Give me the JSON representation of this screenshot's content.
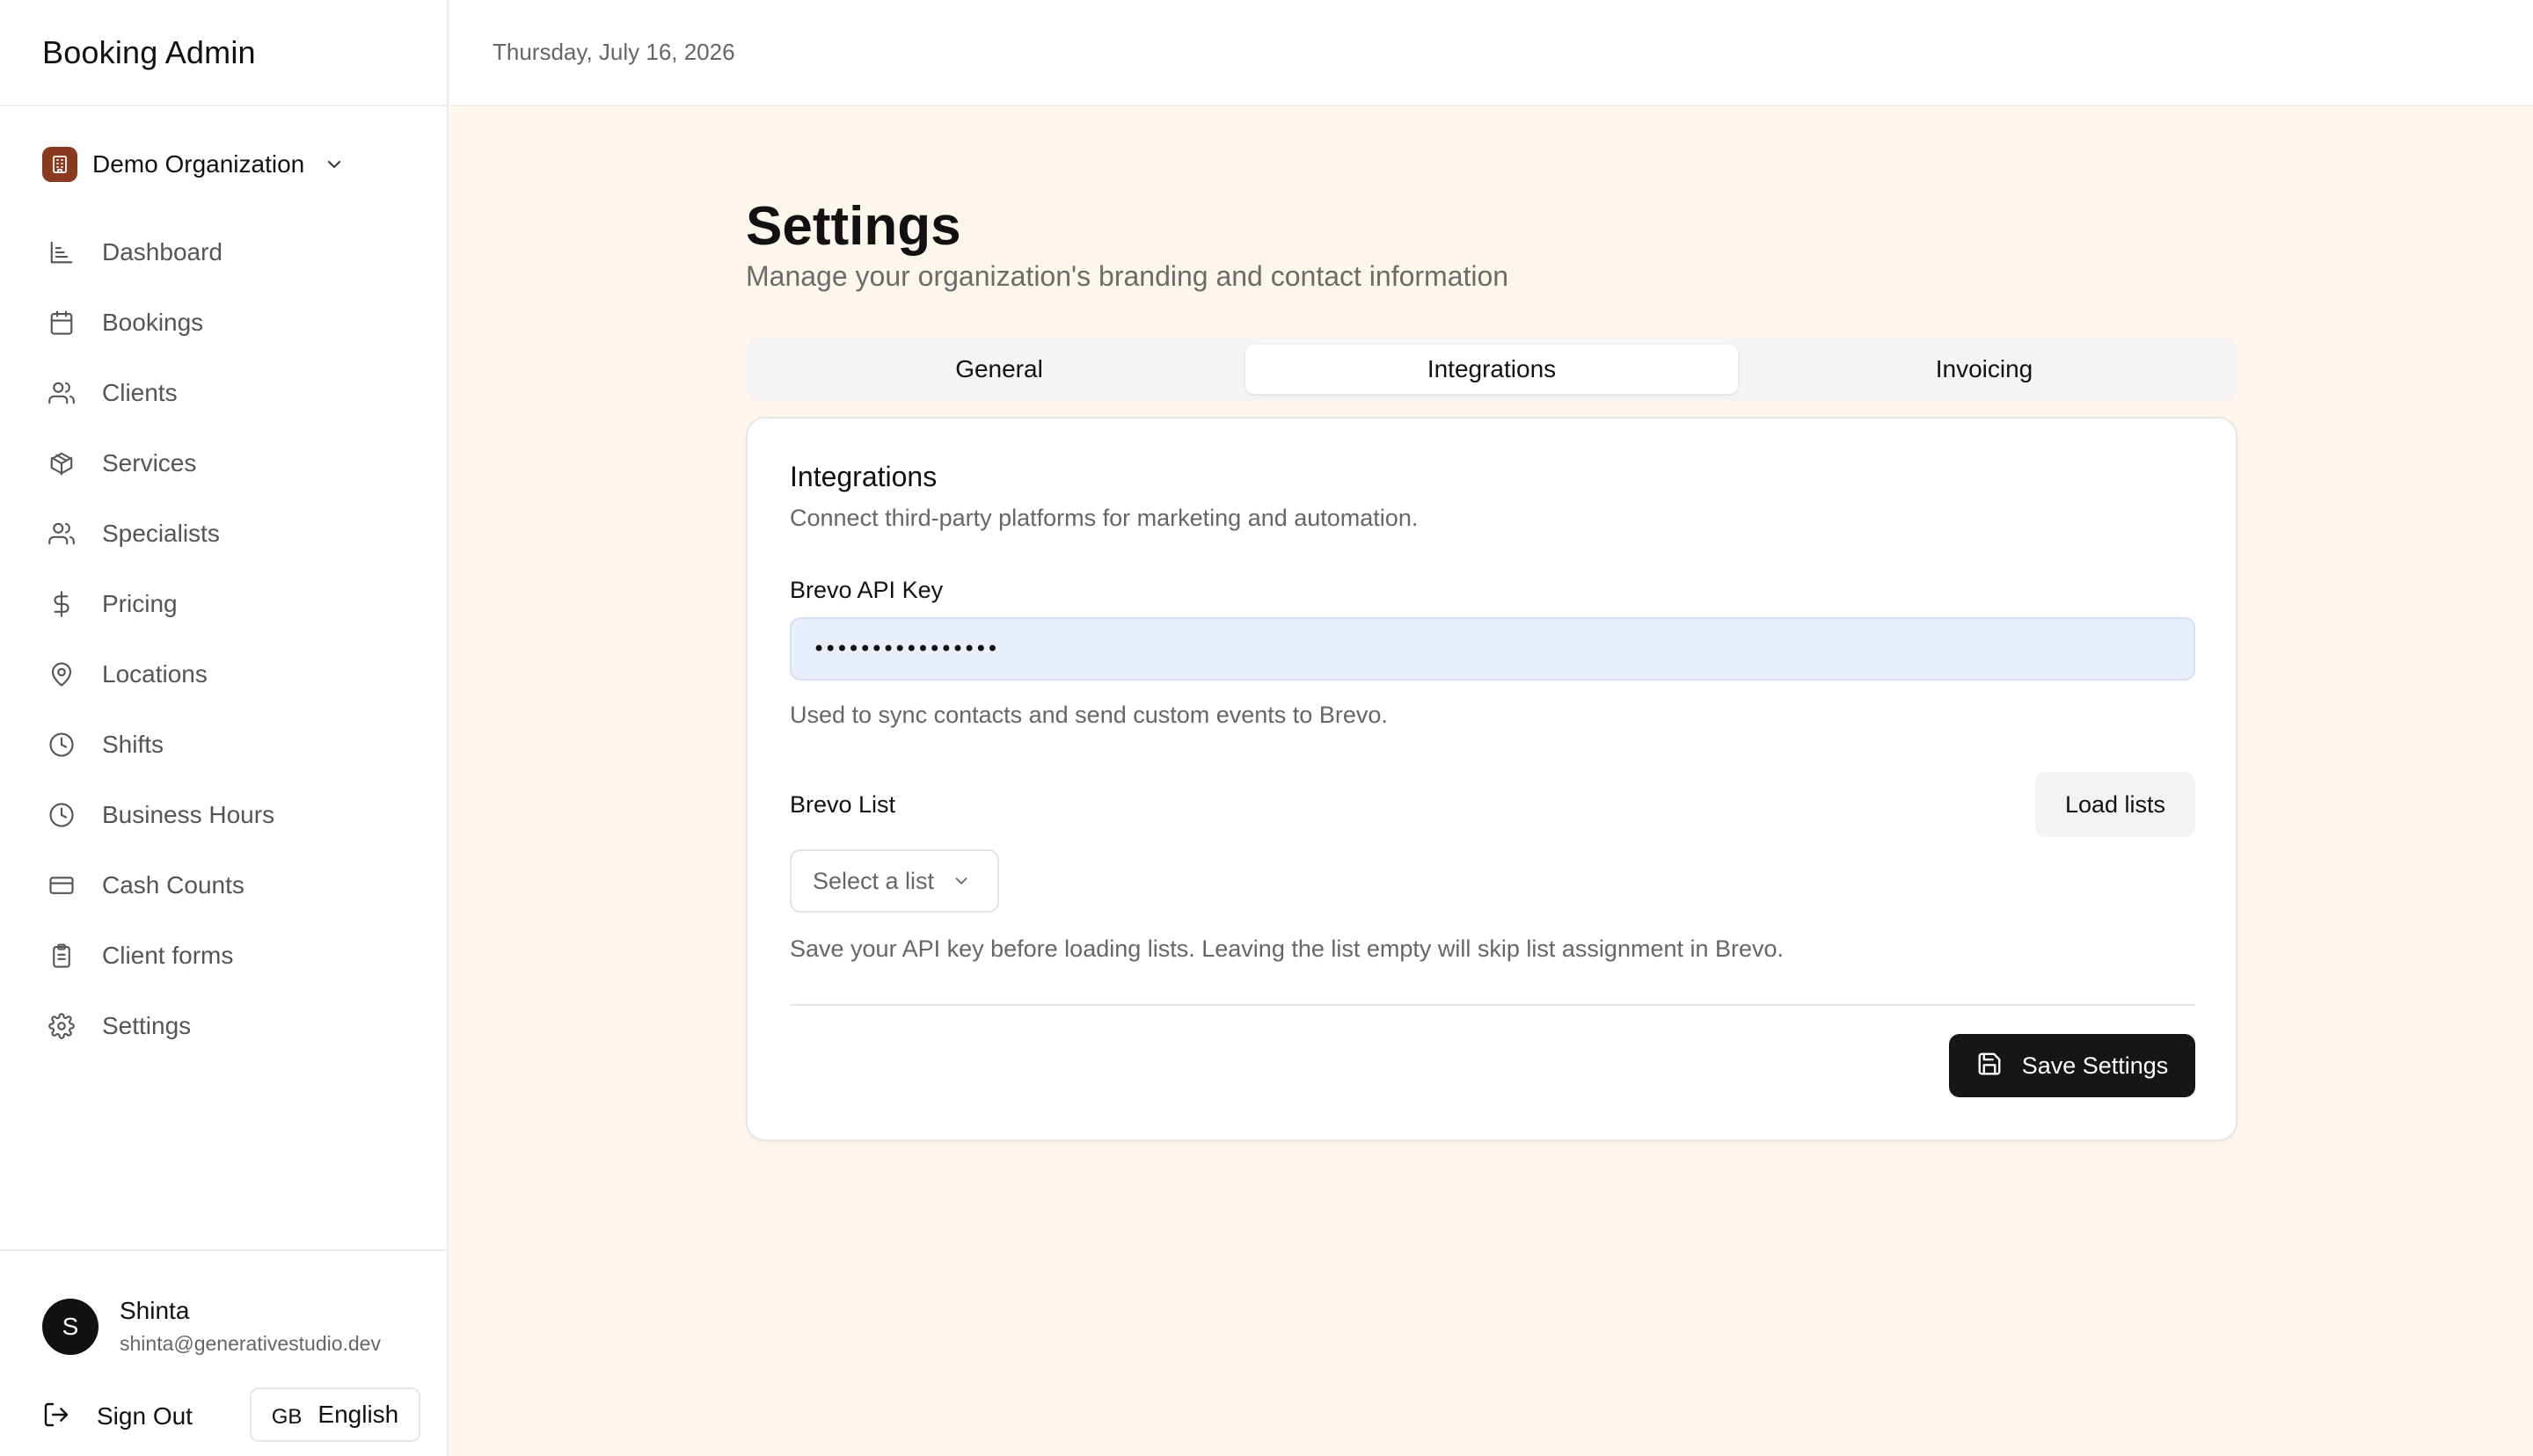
{
  "app": {
    "title": "Booking Admin"
  },
  "organization": {
    "name": "Demo Organization"
  },
  "sidebar": {
    "items": [
      {
        "label": "Dashboard",
        "icon": "chart-icon"
      },
      {
        "label": "Bookings",
        "icon": "calendar-icon"
      },
      {
        "label": "Clients",
        "icon": "users-icon"
      },
      {
        "label": "Services",
        "icon": "package-icon"
      },
      {
        "label": "Specialists",
        "icon": "users-icon"
      },
      {
        "label": "Pricing",
        "icon": "dollar-icon"
      },
      {
        "label": "Locations",
        "icon": "map-pin-icon"
      },
      {
        "label": "Shifts",
        "icon": "clock-icon"
      },
      {
        "label": "Business Hours",
        "icon": "clock-icon"
      },
      {
        "label": "Cash Counts",
        "icon": "credit-card-icon"
      },
      {
        "label": "Client forms",
        "icon": "clipboard-icon"
      },
      {
        "label": "Settings",
        "icon": "gear-icon"
      }
    ]
  },
  "user": {
    "initial": "S",
    "name": "Shinta",
    "email": "shinta@generativestudio.dev",
    "sign_out_label": "Sign Out"
  },
  "language": {
    "flag": "GB",
    "label": "English"
  },
  "header": {
    "date": "Thursday, July 16, 2026"
  },
  "page": {
    "title": "Settings",
    "subtitle": "Manage your organization's branding and contact information"
  },
  "tabs": [
    {
      "label": "General",
      "active": false
    },
    {
      "label": "Integrations",
      "active": true
    },
    {
      "label": "Invoicing",
      "active": false
    }
  ],
  "integrations": {
    "title": "Integrations",
    "subtitle": "Connect third-party platforms for marketing and automation.",
    "api_key_label": "Brevo API Key",
    "api_key_value": "••••••••••••••••",
    "api_key_help": "Used to sync contacts and send custom events to Brevo.",
    "list_label": "Brevo List",
    "load_lists_label": "Load lists",
    "select_placeholder": "Select a list",
    "list_help": "Save your API key before loading lists. Leaving the list empty will skip list assignment in Brevo.",
    "save_label": "Save Settings"
  },
  "colors": {
    "background": "#fdf6ec",
    "org_logo": "#8a3a1f",
    "input_fill": "#e8effb",
    "primary_button": "#161616"
  }
}
